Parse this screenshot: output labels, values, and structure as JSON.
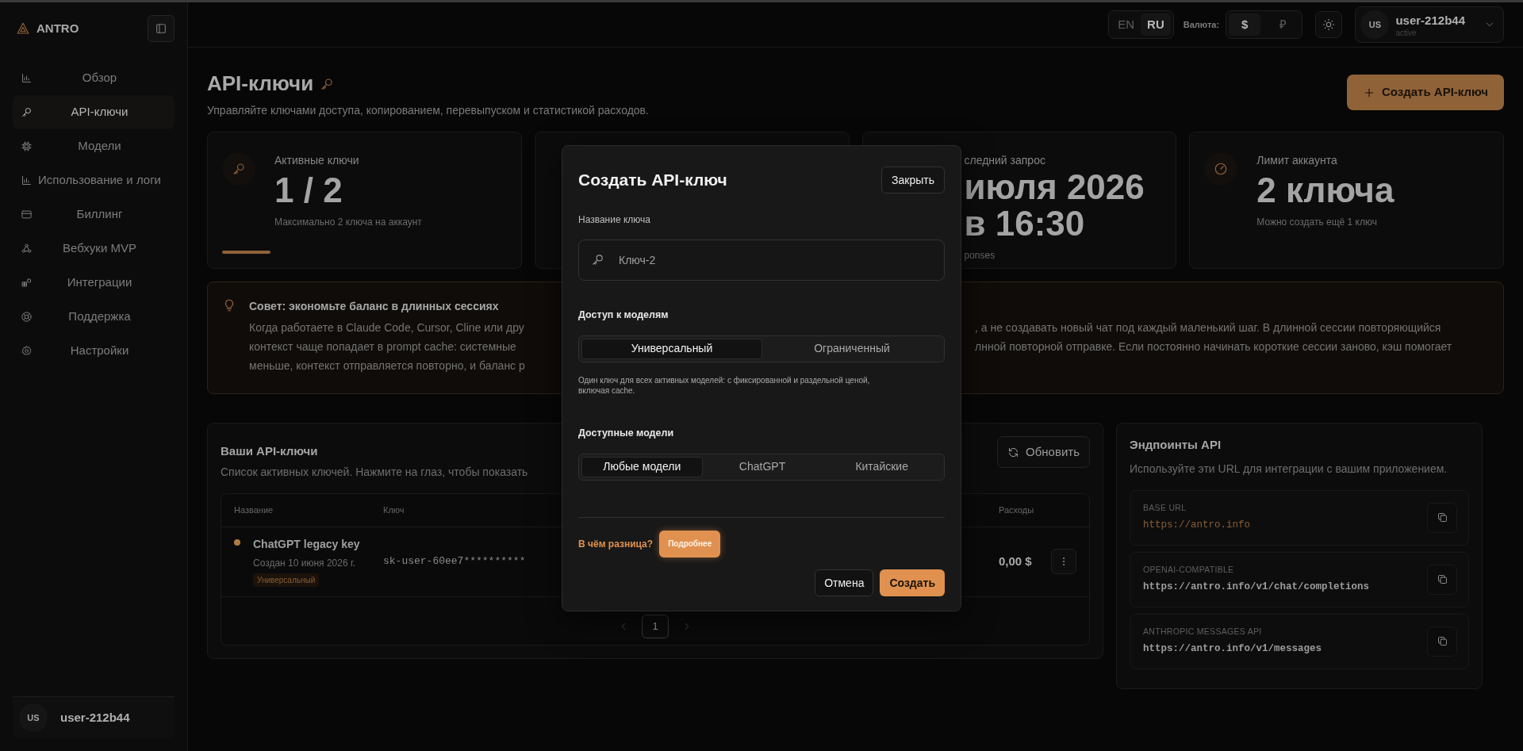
{
  "sidebar": {
    "brand": "ANTRO",
    "items": [
      {
        "label": "Обзор",
        "selected": false
      },
      {
        "label": "API-ключи",
        "selected": true
      },
      {
        "label": "Модели",
        "selected": false
      },
      {
        "label": "Использование и логи",
        "selected": false
      },
      {
        "label": "Биллинг",
        "selected": false
      },
      {
        "label": "Вебхуки MVP",
        "selected": false
      },
      {
        "label": "Интеграции",
        "selected": false
      },
      {
        "label": "Поддержка",
        "selected": false
      },
      {
        "label": "Настройки",
        "selected": false
      }
    ],
    "user": {
      "avatar": "US",
      "name": "user-212b44"
    }
  },
  "header": {
    "languages": [
      {
        "label": "EN",
        "selected": false
      },
      {
        "label": "RU",
        "selected": true
      }
    ],
    "currency_label": "Валюта:",
    "currencies": [
      {
        "label": "$",
        "selected": true
      },
      {
        "label": "₽",
        "selected": false
      }
    ],
    "user": {
      "avatar": "US",
      "name": "user-212b44",
      "status": "active"
    }
  },
  "page": {
    "title": "API-ключи",
    "subtitle": "Управляйте ключами доступа, копированием, перевыпуском и статистикой расходов.",
    "create_button": "Создать API-ключ"
  },
  "stats": [
    {
      "label": "Активные ключи",
      "value": "1 / 2",
      "note": "Максимально 2 ключа на аккаунт",
      "level": 0.17
    },
    {
      "label": "следний запрос",
      "value_lines": [
        "июля 2026",
        "в 16:30"
      ],
      "note": "ponses"
    },
    {
      "label": "Лимит аккаунта",
      "value": "2 ключа",
      "note": "Можно создать ещё 1 ключ"
    }
  ],
  "tip": {
    "title": "Совет: экономьте баланс в длинных сессиях",
    "left_lines": [
      "Когда работаете в Claude Code, Cursor, Cline или дру",
      "контекст чаще попадает в prompt cache: системные",
      "меньше, контекст отправляется повторно, и баланс р"
    ],
    "right_lines": [
      ", а не создавать новый чат под каждый маленький шаг. В длинной сессии повторяющийся",
      "лнной повторной отправке. Если постоянно начинать короткие сессии заново, кэш помогает"
    ]
  },
  "keys": {
    "title": "Ваши API-ключи",
    "subtitle": "Список активных ключей. Нажмите на глаз, чтобы показать",
    "refresh_button": "Обновить",
    "table": {
      "columns": [
        "Название",
        "Ключ",
        "Расходы"
      ],
      "rows": [
        {
          "name": "ChatGPT legacy key",
          "created": "Создан 10 июня 2026 г.",
          "badge": "Универсальный",
          "key": "sk-user-60ee7**********",
          "spend": "0,00 $",
          "color": "#b07a45"
        }
      ]
    },
    "pagination": [
      {
        "label": "1",
        "selected": true
      }
    ]
  },
  "endpoints": {
    "title": "Эндпоинты API",
    "subtitle": "Используйте эти URL для интеграции с вашим приложением.",
    "items": [
      {
        "label": "BASE URL",
        "url": "https://antro.info",
        "accent": true
      },
      {
        "label": "OPENAI-COMPATIBLE",
        "url": "https://antro.info/v1/chat/completions",
        "accent": false
      },
      {
        "label": "ANTHROPIC MESSAGES API",
        "url": "https://antro.info/v1/messages",
        "accent": false
      }
    ]
  },
  "modal": {
    "title": "Создать API-ключ",
    "close_button": "Закрыть",
    "name_label": "Название ключа",
    "name_placeholder": "Ключ-2",
    "access_label": "Доступ к моделям",
    "access_options": [
      {
        "label": "Универсальный",
        "selected": true
      },
      {
        "label": "Ограниченный",
        "selected": false
      }
    ],
    "access_help": "Один ключ для всех активных моделей: с фиксированной и раздельной ценой, включая cache.",
    "models_label": "Доступные модели",
    "model_options": [
      {
        "label": "Любые модели",
        "selected": true
      },
      {
        "label": "ChatGPT",
        "selected": false
      },
      {
        "label": "Китайские",
        "selected": false
      }
    ],
    "diff_label": "В чём разница?",
    "details_button": "Подробнее",
    "cancel_button": "Отмена",
    "submit_button": "Создать"
  }
}
